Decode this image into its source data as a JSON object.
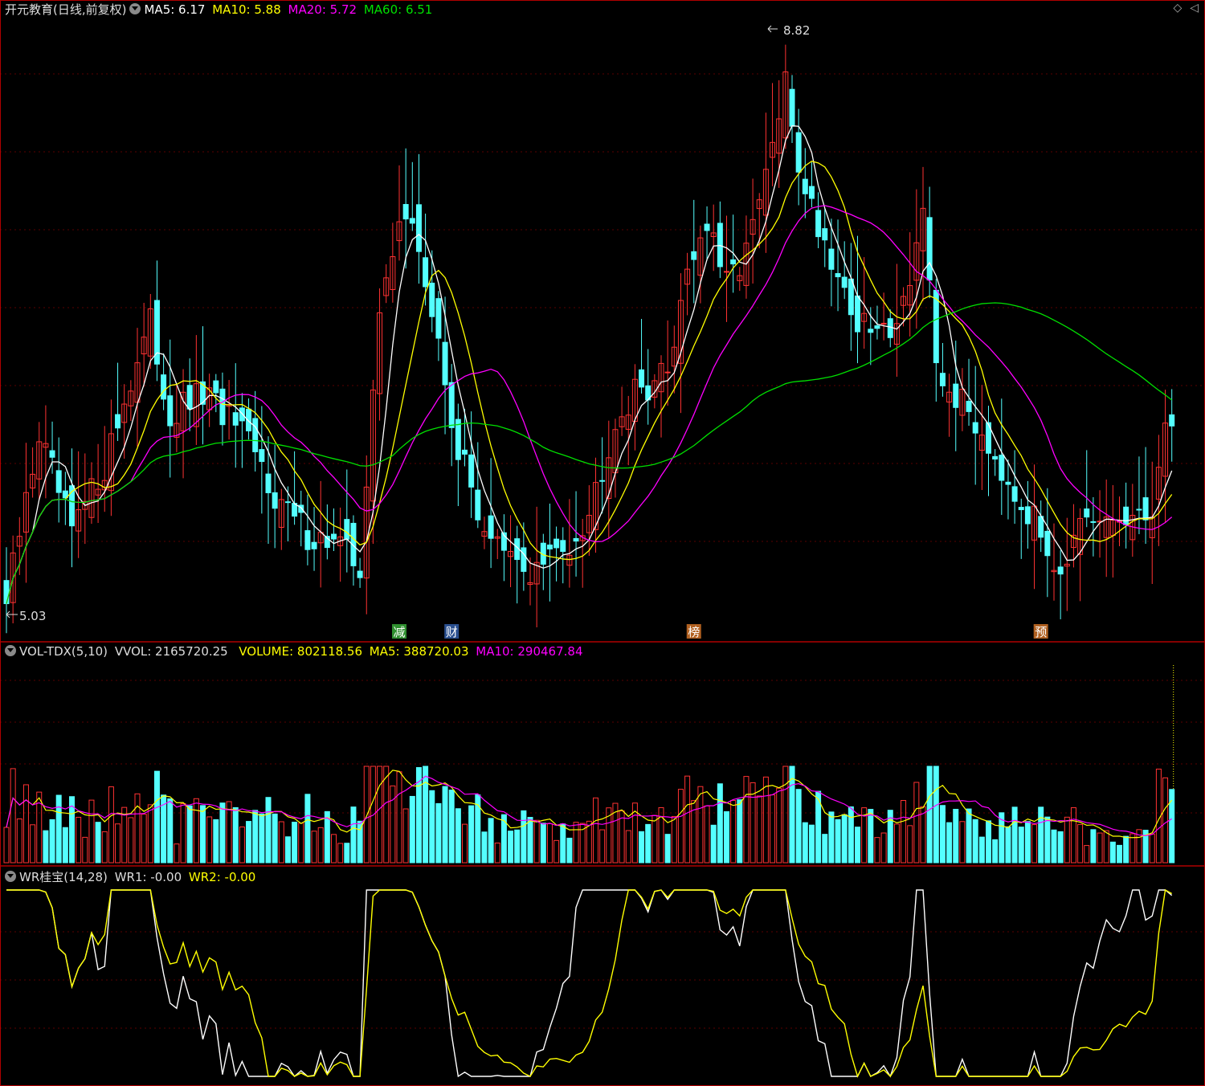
{
  "main_header": {
    "title": "开元教育(日线,前复权)",
    "ma5": "MA5: 6.17",
    "ma10": "MA10: 5.88",
    "ma20": "MA20: 5.72",
    "ma60": "MA60: 6.51"
  },
  "window_controls": {
    "icon1": "◇",
    "icon2": "◁"
  },
  "volume_header": {
    "title": "VOL-TDX(5,10)",
    "vvol": "VVOL: 2165720.25",
    "volume": "VOLUME: 802118.56",
    "ma5": "MA5: 388720.03",
    "ma10": "MA10: 290467.84"
  },
  "wr_header": {
    "title": "WR桂宝(14,28)",
    "wr1": "WR1: -0.00",
    "wr2": "WR2: -0.00"
  },
  "price_annotations": {
    "high": "8.82",
    "low": "5.03"
  },
  "event_markers": [
    {
      "label": "减",
      "bar": 60,
      "color": "#2f8f2f"
    },
    {
      "label": "财",
      "bar": 68,
      "color": "#2a4f8f"
    },
    {
      "label": "榜",
      "bar": 105,
      "color": "#b06020"
    },
    {
      "label": "预",
      "bar": 158,
      "color": "#b06020"
    }
  ],
  "colors": {
    "up": "#ff3232",
    "down": "#54ffff",
    "ma5": "#ffffff",
    "ma10": "#ffff00",
    "ma20": "#ff00ff",
    "ma60": "#00e000",
    "grid": "#5a0000",
    "divider": "#b00000"
  },
  "chart_data": {
    "type": "candlestick",
    "bars": 179,
    "price_range": [
      5.03,
      8.82
    ],
    "latest": {
      "MA5": 6.17,
      "MA10": 5.88,
      "MA20": 5.72,
      "MA60": 6.51
    },
    "volume_latest": {
      "VVOL": 2165720.25,
      "VOLUME": 802118.56,
      "MA5": 388720.03,
      "MA10": 290467.84
    },
    "wr_latest": {
      "WR1": -0.0,
      "WR2": -0.0
    },
    "close_keypoints": [
      [
        0,
        5.1
      ],
      [
        5,
        6.2
      ],
      [
        10,
        5.55
      ],
      [
        15,
        6.0
      ],
      [
        19,
        6.55
      ],
      [
        22,
        6.9
      ],
      [
        25,
        6.3
      ],
      [
        30,
        6.45
      ],
      [
        34,
        6.3
      ],
      [
        38,
        6.05
      ],
      [
        42,
        5.75
      ],
      [
        46,
        5.55
      ],
      [
        50,
        5.5
      ],
      [
        54,
        5.35
      ],
      [
        57,
        6.95
      ],
      [
        60,
        7.65
      ],
      [
        63,
        7.4
      ],
      [
        66,
        6.75
      ],
      [
        69,
        6.1
      ],
      [
        72,
        5.7
      ],
      [
        76,
        5.4
      ],
      [
        80,
        5.3
      ],
      [
        85,
        5.45
      ],
      [
        89,
        5.7
      ],
      [
        93,
        6.3
      ],
      [
        97,
        6.5
      ],
      [
        101,
        6.6
      ],
      [
        104,
        7.3
      ],
      [
        107,
        7.55
      ],
      [
        110,
        7.15
      ],
      [
        114,
        7.5
      ],
      [
        117,
        8.05
      ],
      [
        119,
        8.45
      ],
      [
        121,
        7.95
      ],
      [
        124,
        7.55
      ],
      [
        127,
        7.25
      ],
      [
        130,
        6.9
      ],
      [
        134,
        6.85
      ],
      [
        137,
        7.05
      ],
      [
        140,
        7.65
      ],
      [
        142,
        6.55
      ],
      [
        146,
        6.4
      ],
      [
        150,
        6.15
      ],
      [
        154,
        5.85
      ],
      [
        158,
        5.55
      ],
      [
        161,
        5.35
      ],
      [
        164,
        5.55
      ],
      [
        167,
        5.6
      ],
      [
        170,
        5.65
      ],
      [
        173,
        5.6
      ],
      [
        175,
        5.75
      ],
      [
        177,
        6.2
      ],
      [
        178,
        6.25
      ]
    ]
  }
}
